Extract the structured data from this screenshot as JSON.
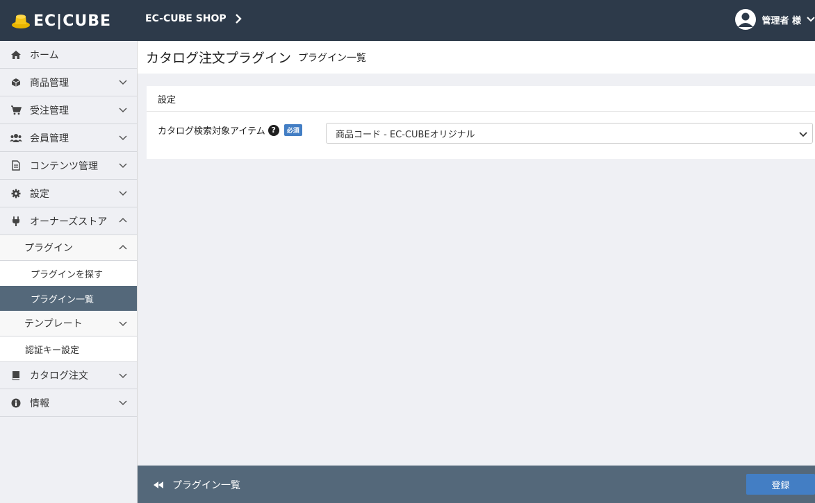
{
  "header": {
    "logo_text": "EC|CUBE",
    "shop_name": "EC-CUBE SHOP",
    "user_name": "管理者 様"
  },
  "sidebar": {
    "items": [
      {
        "label": "ホーム",
        "icon": "home-icon"
      },
      {
        "label": "商品管理",
        "icon": "box-icon"
      },
      {
        "label": "受注管理",
        "icon": "cart-icon"
      },
      {
        "label": "会員管理",
        "icon": "users-icon"
      },
      {
        "label": "コンテンツ管理",
        "icon": "document-icon"
      },
      {
        "label": "設定",
        "icon": "gear-icon"
      },
      {
        "label": "オーナーズストア",
        "icon": "plug-icon"
      }
    ],
    "plugin_group": "プラグイン",
    "plugin_children": [
      "プラグインを探す",
      "プラグイン一覧"
    ],
    "template_group": "テンプレート",
    "auth_key": "認証キー設定",
    "after_items": [
      {
        "label": "カタログ注文",
        "icon": "book-icon"
      },
      {
        "label": "情報",
        "icon": "info-icon"
      }
    ]
  },
  "page": {
    "title": "カタログ注文プラグイン",
    "subtitle": "プラグイン一覧"
  },
  "card": {
    "header": "設定",
    "field_label": "カタログ検索対象アイテム",
    "required_badge": "必須",
    "select_value": "商品コード - EC-CUBEオリジナル"
  },
  "footer": {
    "back_label": "プラグイン一覧",
    "submit_label": "登録"
  },
  "colors": {
    "header_bg": "#2d3a4a",
    "footer_bg": "#54687a",
    "accent": "#437ec4",
    "active_nav": "#54687a"
  }
}
